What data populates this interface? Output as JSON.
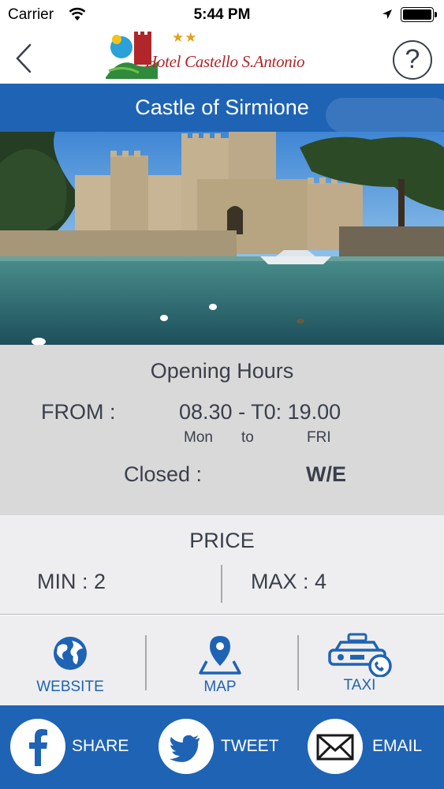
{
  "status_bar": {
    "carrier": "Carrier",
    "time": "5:44 PM"
  },
  "nav": {
    "back_icon": "chevron-left-icon",
    "help_label": "?",
    "logo_text": "Hotel Castello S.Antonio",
    "logo_stars": "★★"
  },
  "title": "Castle of Sirmione",
  "opening_hours": {
    "heading": "Opening Hours",
    "from_label": "FROM :",
    "time_range": "08.30 - T0: 19.00",
    "day_start": "Mon",
    "day_to": "to",
    "day_end": "FRI",
    "closed_label": "Closed :",
    "closed_value": "W/E"
  },
  "price": {
    "heading": "PRICE",
    "min_label": "MIN :",
    "min_value": "2",
    "max_label": "MAX :",
    "max_value": "4"
  },
  "links": [
    {
      "label": "WEBSITE",
      "icon": "globe-icon"
    },
    {
      "label": "MAP",
      "icon": "map-pin-icon"
    },
    {
      "label": "TAXI",
      "icon": "taxi-icon"
    }
  ],
  "share": [
    {
      "label": "SHARE",
      "icon": "facebook-icon"
    },
    {
      "label": "TWEET",
      "icon": "twitter-icon"
    },
    {
      "label": "EMAIL",
      "icon": "envelope-icon"
    }
  ],
  "colors": {
    "accent_blue": "#1f63b5",
    "hours_bg": "#d9d9d9",
    "panel_bg": "#eeeef0",
    "logo_red": "#b0262b",
    "star_gold": "#e0a21b"
  }
}
